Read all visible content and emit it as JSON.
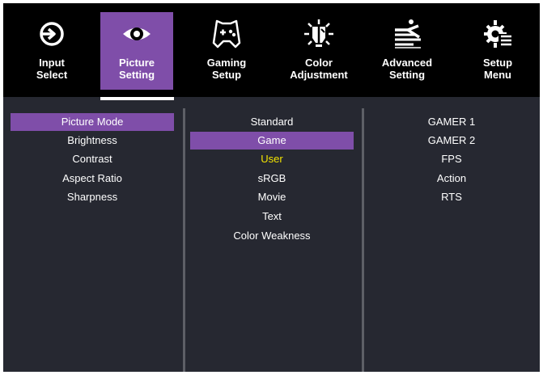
{
  "tabs": [
    {
      "label": "Input\nSelect",
      "icon": "input-select-icon",
      "active": false
    },
    {
      "label": "Picture\nSetting",
      "icon": "picture-eye-icon",
      "active": true
    },
    {
      "label": "Gaming\nSetup",
      "icon": "gamepad-icon",
      "active": false
    },
    {
      "label": "Color\nAdjustment",
      "icon": "color-bulb-icon",
      "active": false
    },
    {
      "label": "Advanced\nSetting",
      "icon": "advanced-setting-icon",
      "active": false
    },
    {
      "label": "Setup\nMenu",
      "icon": "setup-gear-icon",
      "active": false
    }
  ],
  "menu": {
    "items": [
      "Picture Mode",
      "Brightness",
      "Contrast",
      "Aspect Ratio",
      "Sharpness"
    ],
    "selected": "Picture Mode"
  },
  "modes": {
    "items": [
      "Standard",
      "Game",
      "User",
      "sRGB",
      "Movie",
      "Text",
      "Color Weakness"
    ],
    "selected": "Game",
    "current": "User"
  },
  "game_presets": {
    "items": [
      "GAMER 1",
      "GAMER 2",
      "FPS",
      "Action",
      "RTS"
    ]
  },
  "colors": {
    "accent": "#7f4ea9",
    "panel_background": "#262831",
    "tab_bar_background": "#000000",
    "current_value_text": "#f3e400",
    "divider": "#5d5f66"
  }
}
